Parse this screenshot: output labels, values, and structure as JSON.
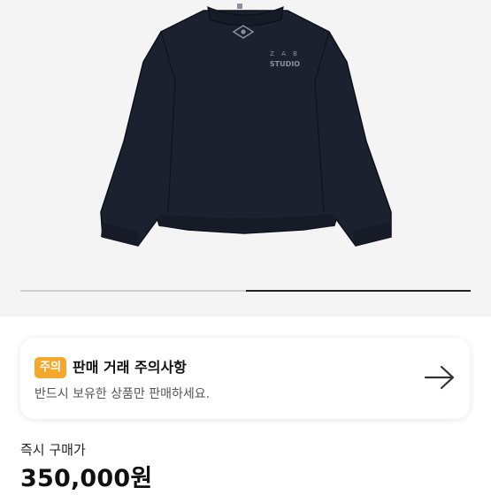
{
  "product": {
    "image_icon": "sweatshirt-image",
    "chest_print_line1": "Z A B",
    "chest_print_line2": "STUDIO"
  },
  "gallery": {
    "current_slide": 2,
    "total_slides": 2
  },
  "notice": {
    "badge": "주의",
    "title": "판매 거래 주의사항",
    "description": "반드시 보유한 상품만 판매하세요.",
    "arrow_icon": "arrow-right-icon"
  },
  "price": {
    "label": "즉시 구매가",
    "value": "350,000원"
  },
  "colors": {
    "badge": "#f4a72a",
    "garment": "#1c2130"
  }
}
